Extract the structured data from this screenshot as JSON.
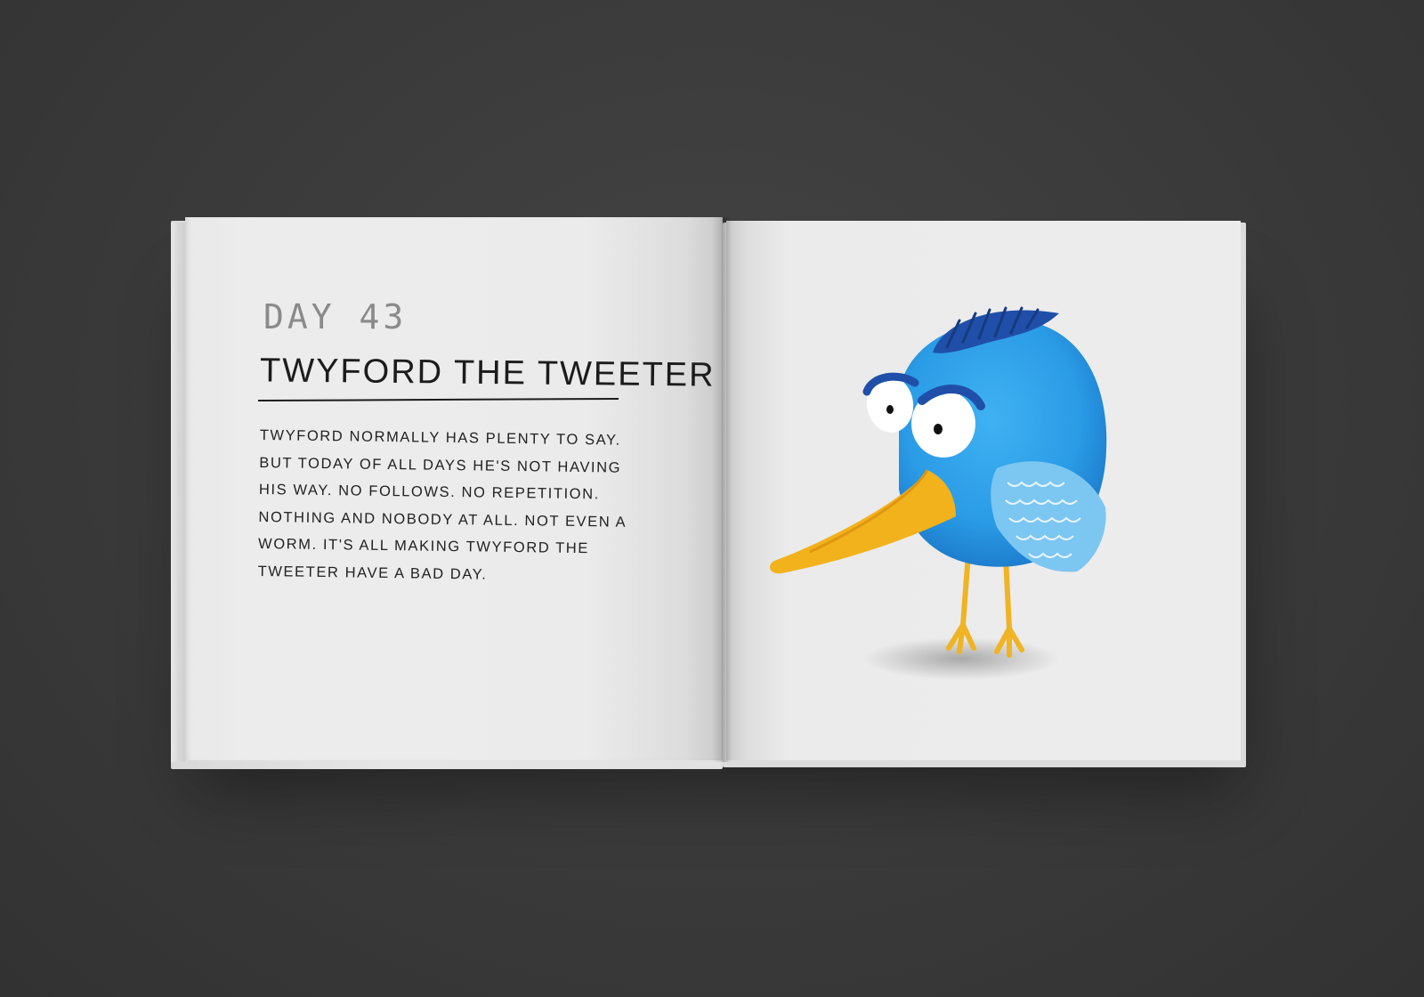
{
  "page": {
    "day_label": "DAY 43",
    "title": "TWYFORD THE TWEETER",
    "body": "TWYFORD NORMALLY HAS PLENTY TO SAY. BUT TODAY OF ALL DAYS HE'S NOT HAVING HIS WAY. NO FOLLOWS. NO REPETITION. NOTHING AND NOBODY AT ALL. NOT EVEN A WORM. IT'S ALL MAKING TWYFORD THE TWEETER HAVE A BAD DAY."
  },
  "illustration": {
    "subject": "sad-blue-bird-icon",
    "colors": {
      "body": "#2a9be6",
      "crest": "#1f4fa8",
      "wing": "#7cc6f2",
      "beak": "#f2b21c",
      "legs": "#f0b323"
    }
  },
  "scene": {
    "background": "#3a3a3a",
    "paper": "#ebebeb"
  }
}
